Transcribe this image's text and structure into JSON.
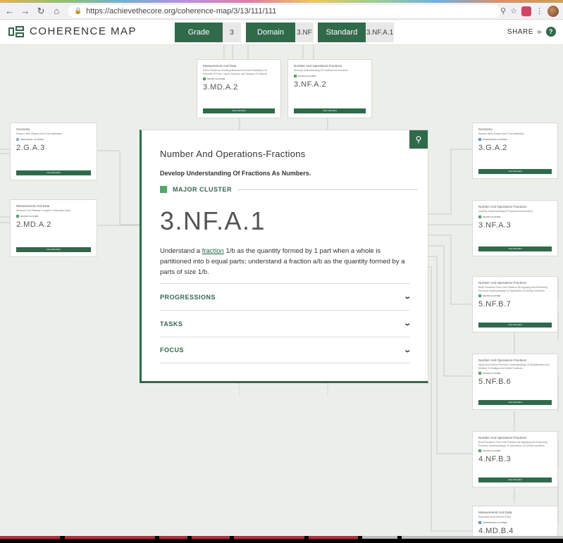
{
  "browser": {
    "url": "https://achievethecore.org/coherence-map/3/13/111/111",
    "back_icon": "arrow-left",
    "forward_icon": "arrow-right",
    "reload_icon": "reload",
    "home_icon": "home"
  },
  "header": {
    "logo_text": "COHERENCE MAP",
    "filters": [
      {
        "label": "Grade",
        "value": "3"
      },
      {
        "label": "Domain",
        "value": "3.NF"
      },
      {
        "label": "Standard",
        "value": "3.NF.A.1"
      }
    ],
    "share_label": "SHARE",
    "help_label": "?"
  },
  "colors": {
    "brand": "#2f6b4b",
    "major": "#4da966",
    "supporting": "#5b9bd5",
    "additional": "#8ab2c9"
  },
  "main_card": {
    "domain": "Number And Operations-Fractions",
    "cluster": "Develop Understanding Of Fractions As Numbers.",
    "cluster_type": "MAJOR CLUSTER",
    "code": "3.NF.A.1",
    "text_before": "Understand a ",
    "text_link": "fraction",
    "text_after": " 1/b as the quantity formed by 1 part when a whole is partitioned into b equal parts; understand a fraction a/b as the quantity formed by a parts of size 1/b.",
    "sections": [
      "PROGRESSIONS",
      "TASKS",
      "FOCUS"
    ]
  },
  "cards": [
    {
      "domain": "Measurement And Data",
      "cluster": "Solve Problems Involving Measurement And Estimation Of Intervals Of Time, Liquid Volumes, And Masses Of Objects.",
      "badge": "MAJOR CLUSTER",
      "code": "3.MD.A.2",
      "view": "View Standard"
    },
    {
      "domain": "Number And Operations-Fractions",
      "cluster": "Develop Understanding Of Fractions As Numbers.",
      "badge": "MAJOR CLUSTER",
      "code": "3.NF.A.2",
      "view": "View Standard"
    },
    {
      "domain": "Geometry",
      "cluster": "Reason With Shapes And Their Attributes.",
      "badge": "ADDITIONAL CLUSTER",
      "code": "2.G.A.3",
      "view": "View Standard"
    },
    {
      "domain": "Measurement And Data",
      "cluster": "Measure And Estimate Lengths In Standard Units.",
      "badge": "MAJOR CLUSTER",
      "code": "2.MD.A.2",
      "view": "View Standard"
    },
    {
      "domain": "Geometry",
      "cluster": "Reason With Shapes And Their Attributes.",
      "badge": "SUPPORTING CLUSTER",
      "code": "3.G.A.2",
      "view": "View Standard"
    },
    {
      "domain": "Number And Operations-Fractions",
      "cluster": "Develop Understanding Of Fractions As Numbers.",
      "badge": "MAJOR CLUSTER",
      "code": "3.NF.A.3",
      "view": "View Standard"
    },
    {
      "domain": "Number And Operations-Fractions",
      "cluster": "Build Fractions From Unit Fractions By Applying And Extending Previous Understandings Of Operations On Whole Numbers.",
      "badge": "MAJOR CLUSTER",
      "code": "5.NF.B.7",
      "view": "View Standard"
    },
    {
      "domain": "Number And Operations-Fractions",
      "cluster": "Apply And Extend Previous Understandings Of Multiplication And Division To Multiply And Divide Fractions.",
      "badge": "MAJOR CLUSTER",
      "code": "5.NF.B.6",
      "view": "View Standard"
    },
    {
      "domain": "Number And Operations-Fractions",
      "cluster": "Build Fractions From Unit Fractions By Applying And Extending Previous Understandings Of Operations On Whole Numbers.",
      "badge": "MAJOR CLUSTER",
      "code": "4.NF.B.3",
      "view": "View Standard"
    },
    {
      "domain": "Measurement And Data",
      "cluster": "Represent And Interpret Data.",
      "badge": "SUPPORTING CLUSTER",
      "code": "4.MD.B.4",
      "view": ""
    }
  ]
}
